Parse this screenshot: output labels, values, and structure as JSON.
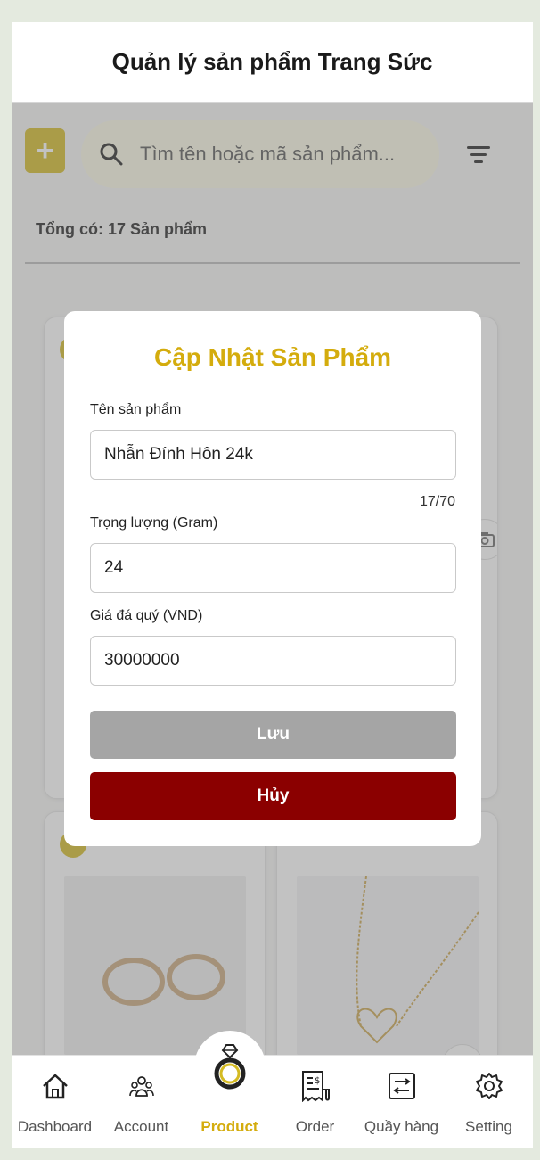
{
  "header": {
    "title": "Quản lý sản phẩm Trang Sức"
  },
  "toolbar": {
    "add_icon": "plus-icon",
    "search_placeholder": "Tìm tên hoặc mã sản phẩm...",
    "search_icon": "search-icon",
    "filter_icon": "filter-icon"
  },
  "summary": {
    "total_text": "Tổng có: 17 Sản phẩm"
  },
  "products": [
    {
      "image": "gold-ring"
    },
    {
      "image": "jewelry-item"
    },
    {
      "image": "hoop-earrings"
    },
    {
      "image": "heart-necklace"
    }
  ],
  "modal": {
    "title": "Cập Nhật Sản Phẩm",
    "name_label": "Tên sản phẩm",
    "name_value": "Nhẫn Đính Hôn 24k",
    "name_counter": "17/70",
    "weight_label": "Trọng lượng (Gram)",
    "weight_value": "24",
    "price_label": "Giá đá quý (VND)",
    "price_value": "30000000",
    "save_label": "Lưu",
    "cancel_label": "Hủy"
  },
  "tabbar": {
    "items": [
      {
        "label": "Dashboard",
        "icon": "home-icon"
      },
      {
        "label": "Account",
        "icon": "users-icon"
      },
      {
        "label": "Product",
        "icon": "ring-icon",
        "active": true
      },
      {
        "label": "Order",
        "icon": "receipt-icon"
      },
      {
        "label": "Quầy hàng",
        "icon": "counter-icon"
      },
      {
        "label": "Setting",
        "icon": "gear-icon"
      }
    ]
  },
  "colors": {
    "accent": "#d4ba22",
    "title_gold": "#d4ac0d",
    "cancel": "#8b0000",
    "save": "#a5a5a5"
  }
}
